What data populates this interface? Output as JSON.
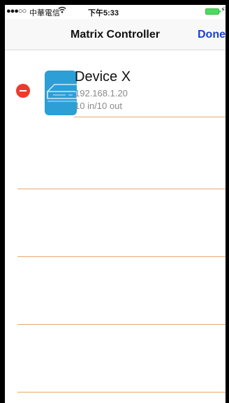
{
  "status_bar": {
    "signal": "●●●○○",
    "carrier": "中華電信",
    "time": "下午5:33",
    "charging_glyph": "⚡"
  },
  "nav": {
    "title": "Matrix Controller",
    "done_label": "Done"
  },
  "devices": [
    {
      "name": "Device X",
      "ip": "192.168.1.20",
      "ports": "10 in/10 out",
      "icon": "matrix-device-icon",
      "icon_color": "#2b9fd6"
    }
  ],
  "colors": {
    "accent": "#1a3fd6",
    "delete": "#ee3a2c",
    "separator": "#e8a870",
    "battery": "#4cd964"
  }
}
